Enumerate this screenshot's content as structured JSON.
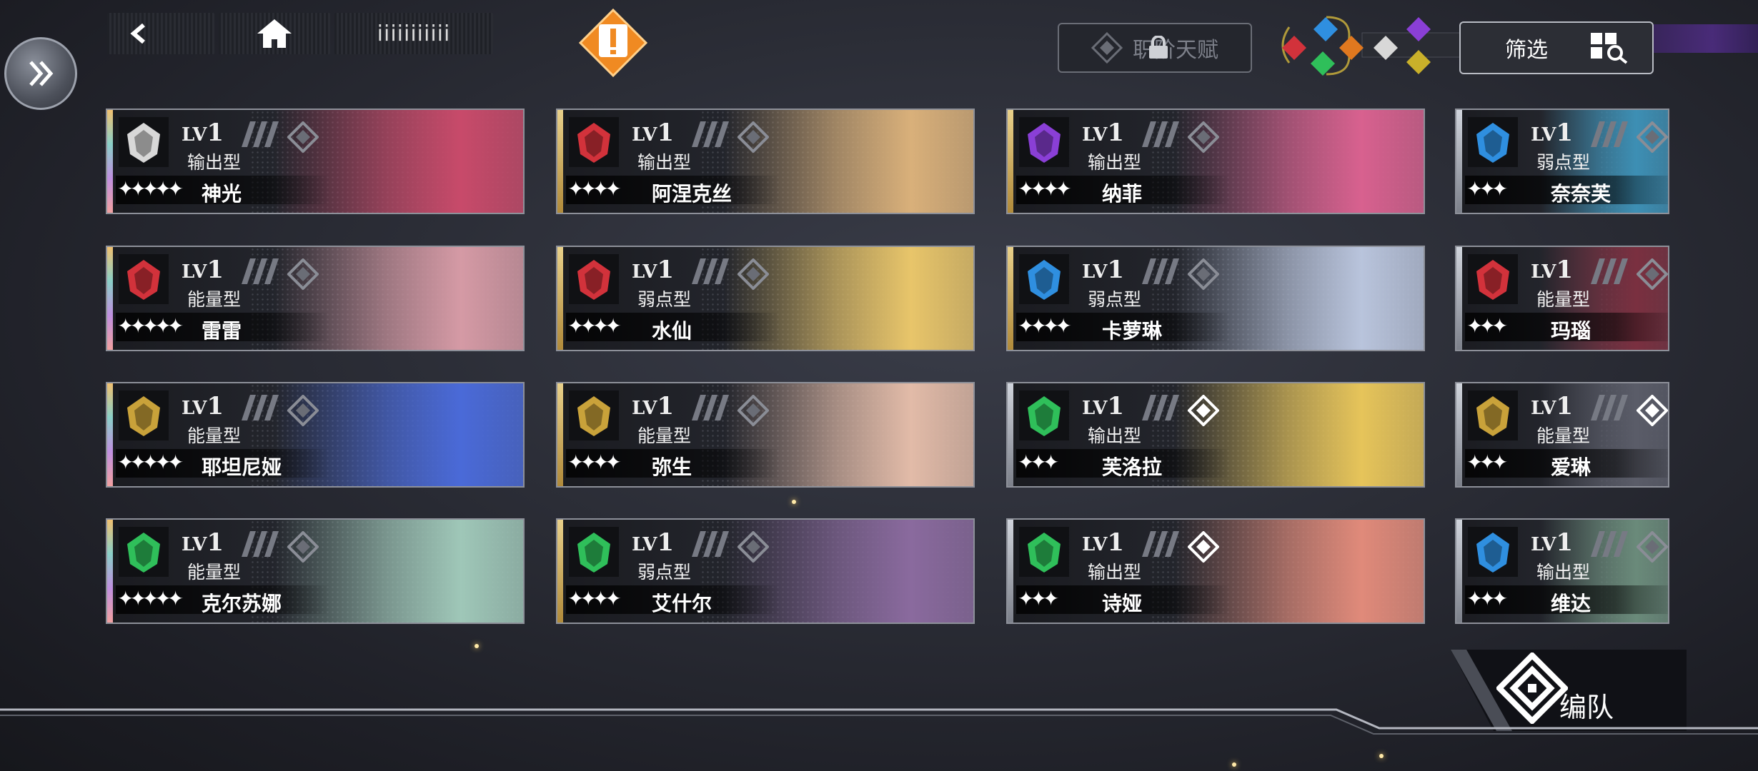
{
  "top_bar": {
    "back_icon": "arrow-left-icon",
    "home_icon": "home-icon",
    "counter_label": "iiiiiiiiiii"
  },
  "talent_button": {
    "label": "职阶天赋",
    "icon": "lock-icon"
  },
  "filter_button": {
    "label": "筛选",
    "icon": "grid-search-icon"
  },
  "team_button": {
    "label": "编队"
  },
  "colors": {
    "red": "#d2323b",
    "gold": "#c9a23a",
    "purple": "#8a3fd6",
    "blue": "#2f8fe0",
    "green": "#2fbf5a",
    "orange": "#e0781f",
    "white": "#d8d8d8",
    "warning": "#f08a22"
  },
  "cards": [
    {
      "level_prefix": "LV",
      "level": "1",
      "type": "输出型",
      "stars": "✦✦✦✦✦",
      "star_count": 5,
      "name": "神光",
      "element": "white",
      "edge": "rainbow",
      "art": "#c84a6a"
    },
    {
      "level_prefix": "LV",
      "level": "1",
      "type": "输出型",
      "stars": "✦✦✦✦",
      "star_count": 4,
      "name": "阿涅克丝",
      "element": "red",
      "edge": "gold",
      "art": "#d9b07a"
    },
    {
      "level_prefix": "LV",
      "level": "1",
      "type": "输出型",
      "stars": "✦✦✦✦",
      "star_count": 4,
      "name": "纳菲",
      "element": "purple",
      "edge": "gold",
      "art": "#d8618f"
    },
    {
      "level_prefix": "LV",
      "level": "1",
      "type": "弱点型",
      "stars": "✦✦✦",
      "star_count": 3,
      "name": "奈奈芙",
      "element": "blue",
      "edge": "silver",
      "art": "#3d8fb4"
    },
    {
      "level_prefix": "LV",
      "level": "1",
      "type": "能量型",
      "stars": "✦✦✦✦✦",
      "star_count": 5,
      "name": "雷雷",
      "element": "red",
      "edge": "rainbow",
      "art": "#d59aa5"
    },
    {
      "level_prefix": "LV",
      "level": "1",
      "type": "弱点型",
      "stars": "✦✦✦✦",
      "star_count": 4,
      "name": "水仙",
      "element": "red",
      "edge": "gold",
      "art": "#e8c56a"
    },
    {
      "level_prefix": "LV",
      "level": "1",
      "type": "弱点型",
      "stars": "✦✦✦✦",
      "star_count": 4,
      "name": "卡萝琳",
      "element": "blue",
      "edge": "gold",
      "art": "#b9c4dc"
    },
    {
      "level_prefix": "LV",
      "level": "1",
      "type": "能量型",
      "stars": "✦✦✦",
      "star_count": 3,
      "name": "玛瑙",
      "element": "red",
      "edge": "silver",
      "art": "#7a3040"
    },
    {
      "level_prefix": "LV",
      "level": "1",
      "type": "能量型",
      "stars": "✦✦✦✦✦",
      "star_count": 5,
      "name": "耶坦尼娅",
      "element": "gold",
      "edge": "rainbow",
      "art": "#4a6ad8"
    },
    {
      "level_prefix": "LV",
      "level": "1",
      "type": "能量型",
      "stars": "✦✦✦✦",
      "star_count": 4,
      "name": "弥生",
      "element": "gold",
      "edge": "gold",
      "art": "#e2bba8"
    },
    {
      "level_prefix": "LV",
      "level": "1",
      "type": "输出型",
      "stars": "✦✦✦",
      "star_count": 3,
      "name": "芙洛拉",
      "element": "green",
      "edge": "silver",
      "art": "#e6c45a"
    },
    {
      "level_prefix": "LV",
      "level": "1",
      "type": "能量型",
      "stars": "✦✦✦",
      "star_count": 3,
      "name": "爱琳",
      "element": "gold",
      "edge": "silver",
      "art": "#5a5c68"
    },
    {
      "level_prefix": "LV",
      "level": "1",
      "type": "能量型",
      "stars": "✦✦✦✦✦",
      "star_count": 5,
      "name": "克尔苏娜",
      "element": "green",
      "edge": "rainbow",
      "art": "#9fc7b8"
    },
    {
      "level_prefix": "LV",
      "level": "1",
      "type": "弱点型",
      "stars": "✦✦✦✦",
      "star_count": 4,
      "name": "艾什尔",
      "element": "green",
      "edge": "gold",
      "art": "#8a6a9e"
    },
    {
      "level_prefix": "LV",
      "level": "1",
      "type": "输出型",
      "stars": "✦✦✦",
      "star_count": 3,
      "name": "诗娅",
      "element": "green",
      "edge": "silver",
      "art": "#e08a7a"
    },
    {
      "level_prefix": "LV",
      "level": "1",
      "type": "输出型",
      "stars": "✦✦✦",
      "star_count": 3,
      "name": "维达",
      "element": "blue",
      "edge": "silver",
      "art": "#6a8a7a"
    }
  ]
}
